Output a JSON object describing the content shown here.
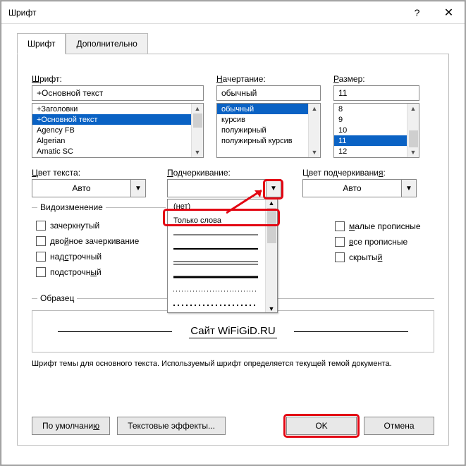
{
  "title": "Шрифт",
  "tabs": {
    "font": "Шрифт",
    "advanced": "Дополнительно"
  },
  "labels": {
    "font": "Шрифт:",
    "style": "Начертание:",
    "size": "Размер:",
    "color": "Цвет текста:",
    "underline": "Подчеркивание:",
    "ucolor": "Цвет подчеркивания:",
    "effects": "Видоизменение",
    "preview": "Образец"
  },
  "inputs": {
    "font_value": "+Основной текст",
    "style_value": "обычный",
    "size_value": "11",
    "color_value": "Авто",
    "ucolor_value": "Авто"
  },
  "font_list": [
    "+Заголовки",
    "+Основной текст",
    "Agency FB",
    "Algerian",
    "Amatic SC"
  ],
  "font_selected": "+Основной текст",
  "style_list": [
    "обычный",
    "курсив",
    "полужирный",
    "полужирный курсив"
  ],
  "style_selected": "обычный",
  "size_list": [
    "8",
    "9",
    "10",
    "11",
    "12"
  ],
  "size_selected": "11",
  "underline_dropdown": {
    "none": "(нет)",
    "words": "Только слова"
  },
  "effects_left": {
    "strike": "зачеркнутый",
    "dstrike": "двойное зачеркивание",
    "superscript": "надстрочный",
    "subscript": "подстрочный"
  },
  "effects_right": {
    "smallcaps": "малые прописные",
    "allcaps": "все прописные",
    "hidden": "скрытый"
  },
  "preview_text": "Сайт WiFiGiD.RU",
  "note": "Шрифт темы для основного текста. Используемый шрифт определяется текущей темой документа.",
  "buttons": {
    "default": "По умолчанию",
    "texteffects": "Текстовые эффекты...",
    "ok": "OK",
    "cancel": "Отмена"
  }
}
